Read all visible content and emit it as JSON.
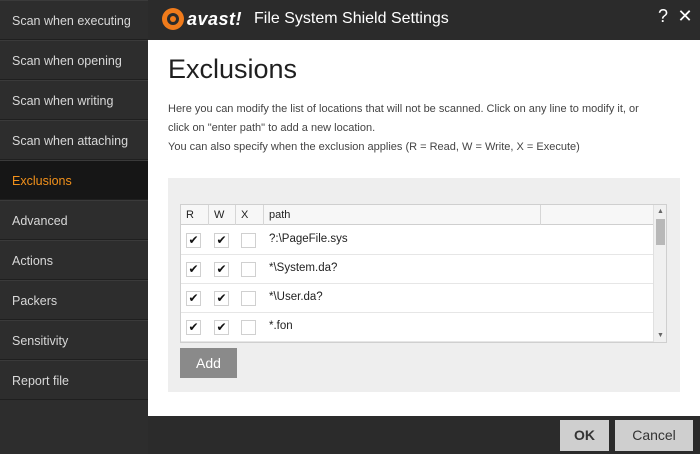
{
  "app": {
    "logo_text": "avast!",
    "window_title": "File System Shield Settings",
    "help_glyph": "?",
    "close_glyph": "✕"
  },
  "sidebar": {
    "items": [
      {
        "label": "Scan when executing",
        "active": false
      },
      {
        "label": "Scan when opening",
        "active": false
      },
      {
        "label": "Scan when writing",
        "active": false
      },
      {
        "label": "Scan when attaching",
        "active": false
      },
      {
        "label": "Exclusions",
        "active": true
      },
      {
        "label": "Advanced",
        "active": false
      },
      {
        "label": "Actions",
        "active": false
      },
      {
        "label": "Packers",
        "active": false
      },
      {
        "label": "Sensitivity",
        "active": false
      },
      {
        "label": "Report file",
        "active": false
      }
    ]
  },
  "main": {
    "heading": "Exclusions",
    "desc_line1": "Here you can modify the list of locations that will not be scanned. Click on any line to modify it, or",
    "desc_line2": "click on \"enter path\" to add a new location.",
    "desc_line3": "You can also specify when the exclusion applies (R = Read, W = Write, X = Execute)",
    "table": {
      "columns": [
        "R",
        "W",
        "X",
        "path"
      ],
      "rows": [
        {
          "r": "✔",
          "w": "✔",
          "x": "",
          "path": "?:\\PageFile.sys"
        },
        {
          "r": "✔",
          "w": "✔",
          "x": "",
          "path": "*\\System.da?"
        },
        {
          "r": "✔",
          "w": "✔",
          "x": "",
          "path": "*\\User.da?"
        },
        {
          "r": "✔",
          "w": "✔",
          "x": "",
          "path": "*.fon"
        }
      ]
    },
    "add_label": "Add"
  },
  "footer": {
    "ok_label": "OK",
    "cancel_label": "Cancel"
  },
  "colors": {
    "accent": "#f2911b",
    "sidebar_bg": "#2d2d2d",
    "active_bg": "#161616"
  }
}
